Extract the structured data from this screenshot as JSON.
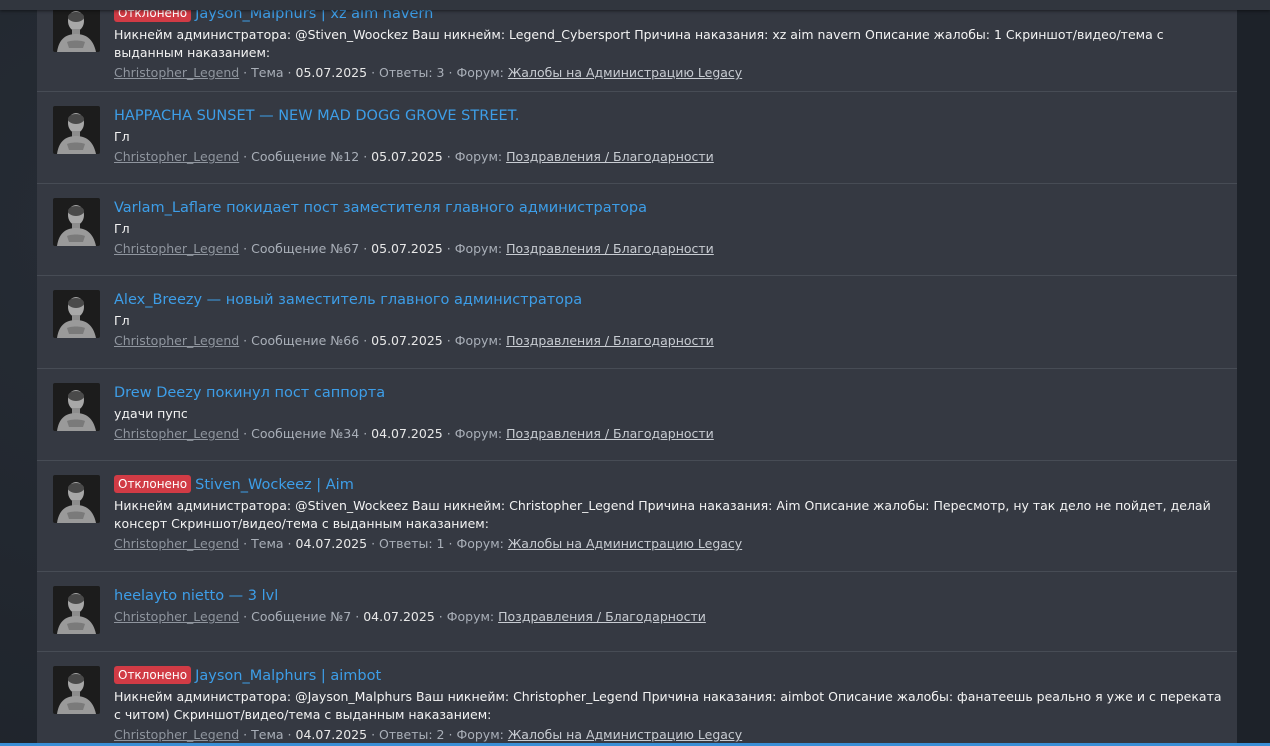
{
  "results": [
    {
      "badge": "Отклонено",
      "title": "Jayson_Malphurs | xz aim navern",
      "snippet": "Никнейм администратора: @Stiven_Woockez Ваш никнейм: Legend_Cybersport Причина наказания: xz aim navern Описание жалобы: 1 Скриншот/видео/тема с выданным наказанием:",
      "author": "Christopher_Legend",
      "type_text": "Тема",
      "date": "05.07.2025",
      "extra": "Ответы: 3",
      "forum_label": "Форум:",
      "forum": "Жалобы на Администрацию Legacy"
    },
    {
      "badge": "",
      "title": "HAPPACHA SUNSET — NEW MAD DOGG GROVE STREET.",
      "snippet": "Гл",
      "author": "Christopher_Legend",
      "type_text": "Сообщение №12",
      "date": "05.07.2025",
      "extra": "",
      "forum_label": "Форум:",
      "forum": "Поздравления / Благодарности"
    },
    {
      "badge": "",
      "title": "Varlam_Laflare покидает пост заместителя главного администратора",
      "snippet": "Гл",
      "author": "Christopher_Legend",
      "type_text": "Сообщение №67",
      "date": "05.07.2025",
      "extra": "",
      "forum_label": "Форум:",
      "forum": "Поздравления / Благодарности"
    },
    {
      "badge": "",
      "title": "Alex_Breezy — новый заместитель главного администратора",
      "snippet": "Гл",
      "author": "Christopher_Legend",
      "type_text": "Сообщение №66",
      "date": "05.07.2025",
      "extra": "",
      "forum_label": "Форум:",
      "forum": "Поздравления / Благодарности"
    },
    {
      "badge": "",
      "title": "Drew Deezy покинул пост саппорта",
      "snippet": "удачи пупс",
      "author": "Christopher_Legend",
      "type_text": "Сообщение №34",
      "date": "04.07.2025",
      "extra": "",
      "forum_label": "Форум:",
      "forum": "Поздравления / Благодарности"
    },
    {
      "badge": "Отклонено",
      "title": "Stiven_Wockeez | Aim",
      "snippet": "Никнейм администратора: @Stiven_Wockeez Ваш никнейм: Christopher_Legend Причина наказания: Aim Описание жалобы: Пересмотр, ну так дело не пойдет, делай консерт Скриншот/видео/тема с выданным наказанием:",
      "author": "Christopher_Legend",
      "type_text": "Тема",
      "date": "04.07.2025",
      "extra": "Ответы: 1",
      "forum_label": "Форум:",
      "forum": "Жалобы на Администрацию Legacy"
    },
    {
      "badge": "",
      "title": "heelayto nietto — 3 lvl",
      "snippet": "",
      "author": "Christopher_Legend",
      "type_text": "Сообщение №7",
      "date": "04.07.2025",
      "extra": "",
      "forum_label": "Форум:",
      "forum": "Поздравления / Благодарности"
    },
    {
      "badge": "Отклонено",
      "title": "Jayson_Malphurs | aimbot",
      "snippet": "Никнейм администратора: @Jayson_Malphurs Ваш никнейм: Christopher_Legend Причина наказания: aimbot Описание жалобы: фанатеешь реально я уже и с переката с читом) Скриншот/видео/тема с выданным наказанием:",
      "author": "Christopher_Legend",
      "type_text": "Тема",
      "date": "04.07.2025",
      "extra": "Ответы: 2",
      "forum_label": "Форум:",
      "forum": "Жалобы на Администрацию Legacy"
    }
  ],
  "colors": {
    "badge": "#d13b45",
    "title_link": "#3d9ee8",
    "panel": "#353942",
    "accent_bar": "#3a8fd6"
  }
}
